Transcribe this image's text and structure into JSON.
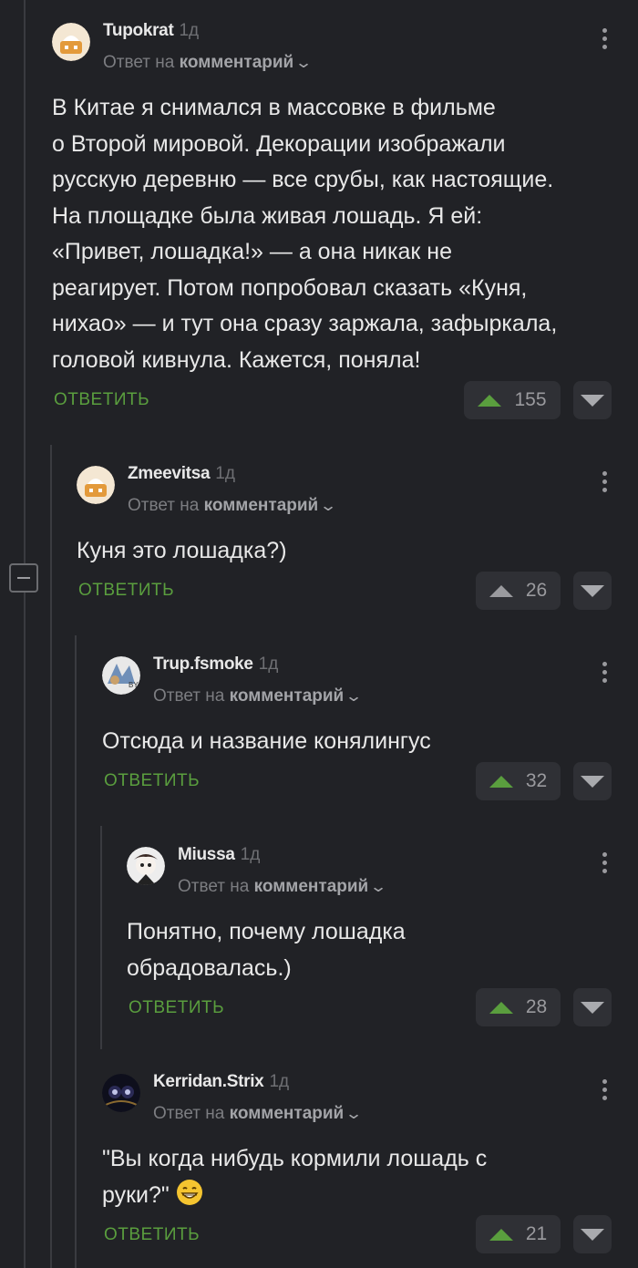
{
  "reply_prefix": "Ответ на",
  "reply_target": "комментарий",
  "reply_label": "ОТВЕТИТЬ",
  "comments": [
    {
      "author": "Tupokrat",
      "time": "1д",
      "lines": [
        "В Китае я снимался в массовке в фильме",
        "о Второй мировой. Декорации изображали",
        "русскую деревню — все срубы, как настоящие.",
        "На площадке была живая лошадь. Я ей:",
        "«Привет, лошадка!» — а она никак не",
        "реагирует. Потом попробовал сказать «Куня,",
        "нихао» — и тут она сразу заржала, зафыркала,",
        "головой кивнула. Кажется, поняла!"
      ],
      "votes": "155",
      "upvoted": true
    },
    {
      "author": "Zmeevitsa",
      "time": "1д",
      "lines": [
        "Куня это лошадка?)"
      ],
      "votes": "26",
      "upvoted": false
    },
    {
      "author": "Trup.fsmoke",
      "time": "1д",
      "lines": [
        "Отсюда и название конялингус"
      ],
      "votes": "32",
      "upvoted": true
    },
    {
      "author": "Miussa",
      "time": "1д",
      "lines": [
        "Понятно, почему лошадка",
        "обрадовалась.)"
      ],
      "votes": "28",
      "upvoted": true
    },
    {
      "author": "Kerridan.Strix",
      "time": "1д",
      "lines": [
        "\"Вы когда нибудь кормили лошадь с",
        "руки?\""
      ],
      "votes": "21",
      "upvoted": true
    }
  ],
  "colors": {
    "background": "#212226",
    "accent": "#5a9e3e",
    "button_bg": "#2f3035"
  }
}
